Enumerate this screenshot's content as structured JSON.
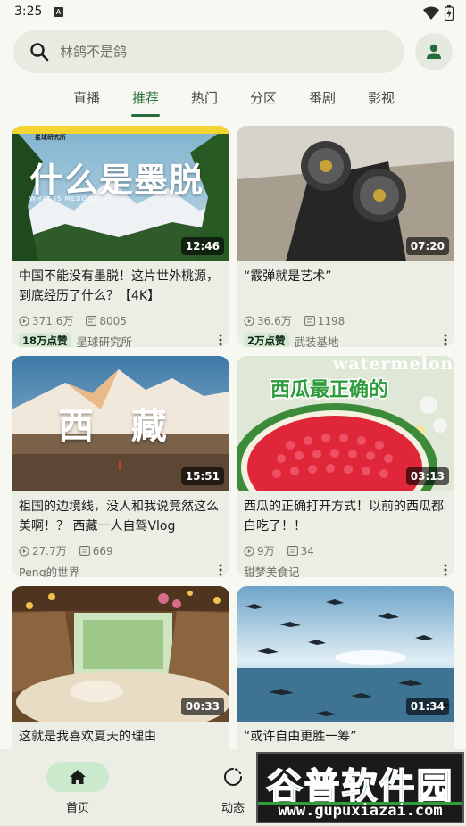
{
  "status_bar": {
    "time": "3:25",
    "a_badge": "A"
  },
  "search": {
    "placeholder": "林鸽不是鸽"
  },
  "tabs": [
    {
      "label": "直播"
    },
    {
      "label": "推荐",
      "active": true
    },
    {
      "label": "热门"
    },
    {
      "label": "分区"
    },
    {
      "label": "番剧"
    },
    {
      "label": "影视"
    }
  ],
  "videos": [
    {
      "title": "中国不能没有墨脱！这片世外桃源，到底经历了什么？【4K】",
      "duration": "12:46",
      "views": "371.6万",
      "danmaku": "8005",
      "badge": "18万点赞",
      "author": "星球研究所",
      "thumb_text": "什么是墨脱",
      "thumb_sub": "WHAT IS MEDOG?",
      "thumb_brand": "星球研究所"
    },
    {
      "title": "“霰弹就是艺术”",
      "duration": "07:20",
      "views": "36.6万",
      "danmaku": "1198",
      "badge": "2万点赞",
      "author": "武装基地"
    },
    {
      "title": "祖国的边境线，没人和我说竟然这么美啊！？ 西藏一人自驾Vlog",
      "duration": "15:51",
      "views": "27.7万",
      "danmaku": "669",
      "badge": "",
      "author": "Peng的世界_",
      "thumb_text": "西   藏"
    },
    {
      "title": "西瓜的正确打开方式！以前的西瓜都白吃了！！",
      "duration": "03:13",
      "views": "9万",
      "danmaku": "34",
      "badge": "",
      "author": "甜梦美食记",
      "thumb_text": "西瓜最正确的",
      "thumb_en": "watermelon"
    },
    {
      "title": "这就是我喜欢夏天的理由",
      "duration": "00:33"
    },
    {
      "title": "“或许自由更胜一筹”",
      "duration": "01:34"
    }
  ],
  "bottom_nav": [
    {
      "label": "首页",
      "icon": "home-icon",
      "active": true
    },
    {
      "label": "动态",
      "icon": "dynamic-icon"
    }
  ],
  "watermark": {
    "text": "谷普软件园",
    "url": "www.gupuxiazai.com"
  },
  "colors": {
    "accent": "#296c3b",
    "background": "#f7f8f1",
    "card": "#ebeee5",
    "badge_bg": "#d6e8d4"
  }
}
